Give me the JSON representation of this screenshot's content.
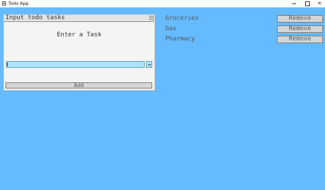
{
  "window": {
    "title": "Todo App",
    "close_glyph": "✕"
  },
  "input_panel": {
    "title": "Input todo tasks",
    "prompt": "Enter a Task",
    "input_value": "",
    "add_label": "Add"
  },
  "tasks": [
    {
      "label": "Groceries",
      "remove_label": "Remove"
    },
    {
      "label": "Gas",
      "remove_label": "Remove"
    },
    {
      "label": "Pharmacy",
      "remove_label": "Remove"
    }
  ],
  "colors": {
    "background": "#66bbff",
    "panel": "#f4f4f4",
    "input": "#a9e4f9",
    "button": "#d6d6d6"
  }
}
